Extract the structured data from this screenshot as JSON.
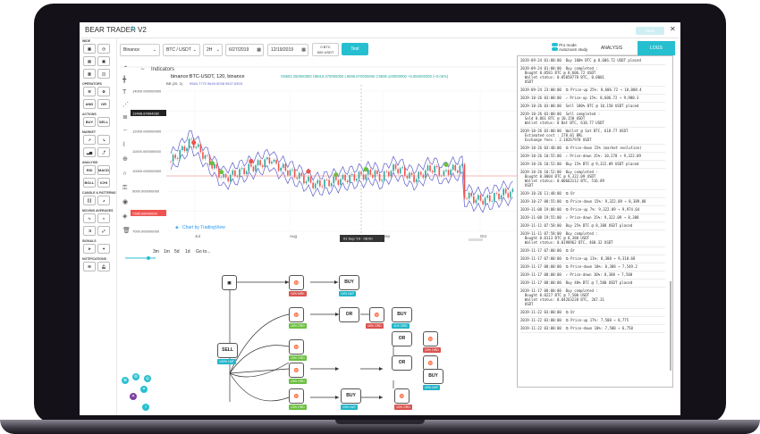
{
  "app": {
    "title": "BEAR TRADER V2",
    "save_label": "Save"
  },
  "sidebar": {
    "sections": [
      "WIDE",
      "OPERATORS",
      "ACTIONS",
      "MARKET",
      "ANALYSIS",
      "CANDLE & PATTERNS",
      "MOVING AVERAGES",
      "SIGNALS",
      "NOTIFICATIONS"
    ],
    "and_label": "AND",
    "or_label": "OR",
    "buy_label": "BUY",
    "sell_label": "SELL",
    "rsi_label": "RSI",
    "macd_label": "MACD",
    "boll_label": "BOLL",
    "ichi_label": "ICHI"
  },
  "controls": {
    "exchange": "Binance",
    "pair": "BTC / USDT",
    "interval": "2H",
    "start_date": "6/27/2019",
    "end_date": "12/19/2019",
    "balance_btc": "0 BTC",
    "balance_usdt": "500 USDT",
    "test_label": "Test"
  },
  "mode": {
    "pro": "Pro mode",
    "autozoom": "Autozoom study"
  },
  "tabs": {
    "analysis": "ANALYSIS",
    "logs": "LOGS"
  },
  "chart": {
    "indicators_label": "Indicators",
    "symbol": "binance:BTC-USDT, 120, binance",
    "ohlc": "O9602.250000000  H9619.370000000  L9595.870000000  C9608.100000000  +5.850000000 (+0.06%)",
    "bb_label": "BB (20, 2)",
    "bb_values": "9563.7770  9649.9038  9537.6303",
    "y_ticks": [
      "14000.000000000",
      "13000.000000000",
      "12000.000000000",
      "11000.000000000",
      "10000.000000000",
      "9000.000000000",
      "8000.000000000",
      "7000.000000000"
    ],
    "price_label_top": "13498.87894282",
    "price_label_bottom": "7385.68000000",
    "x_ticks": [
      "Jul",
      "Aug",
      "Sep",
      "Oct"
    ],
    "crosshair_date": "01 Sep '19 · 08:00",
    "watermark": "Chart by TradingView",
    "ranges": [
      "3m",
      "1m",
      "5d",
      "1d",
      "Go to..."
    ]
  },
  "logs": [
    "2019-09-24 01:00:00  Buy 100% BTC @ 8,606.72 USDT placed",
    "2019-09-24 01:00:00  Buy completed :\n  Bought 0.0581 BTC @ 8,606.72 USDT\n  Wallet status: 0.05058778 BTC, 0.0001\n  USDT",
    "2019-09-24 23:00:00  ⏲ Price-up 25%: 8,606.72 ➔ 10,008.4",
    "2019-10-26 03:00:00  ✓ Price-up 15%: 8,606.72 ➔ 9,980.3",
    "2019-10-26 03:00:00  Sell 100% BTC @ 10,150 USDT placed",
    "2019-10-26 03:00:00  Sell completed :\n  Sold 0.061 BTC @ 10,150 USDT\n  Wallet status: 0 Bat BTC, 618.77 USDT",
    "2019-10-26 03:00:00  Wallet @ Sat BTC, 618.77 USDT\n  Estimated cost : 278.01 BRL\n  Exchange fees : 2.18267978 USDT",
    "2019-10-26 03:40:00  ⏲ Price-down 15% (market evolution)",
    "2019-10-26 10:55:00  ✓ Price-down 15%: 10,278 ➔ 9,322.09",
    "2019-10-26 10:52:00  Buy 15% BTC @ 9,322.09 USDT placed",
    "2019-10-26 10:52:00  Buy completed :\n  Bought 0.0004 BTC @ 9,322.09 USDT\n  Wallet status: 0.00663112 BTC, 516.89\n  USDT",
    "2019-10-26 11:40:00  ⏲ Or",
    "2019-10-27 08:55:00  ⏲ Price-down 15%: 9,322.09 ➔ 8,389.88",
    "2019-11-08 19:00:00  ⏲ Price-up 7%: 9,322.09 ➔ 9,974.64",
    "2019-11-08 19:55:00  ✓ Price-down 15%: 9,322.09 ➔ 8,388",
    "2019-11-11 07:58:00  Buy 25% BTC @ 8,388 USDT placed",
    "2019-11-11 07:58:00  Buy completed :\n  Bought 0.0113 BTC @ 8,388 USDT\n  Wallet status: 0.0198962 BTC, 460.32 USDT",
    "2019-11-17 07:00:00  ⏲ Or",
    "2019-11-17 07:00:00  ⏲ Price-up 11%: 8,388 ➔ 9,310.68",
    "2019-11-17 08:00:00  ⏲ Price-down 10%: 8,388 ➔ 7,549.2",
    "2019-11-17 08:00:00  ✓ Price-down 10%: 8,388 ➔ 7,500",
    "2019-11-17 08:00:00  Buy 40% BTC @ 7,500 USDT placed",
    "2019-11-17 08:00:00  Buy completed :\n  Bought 0.0227 BTC @ 7,500 USDT\n  Wallet status: 0.04263228 BTC, 267.31\n  USDT",
    "2019-11-22 03:00:00  ⏲ Or",
    "2019-11-22 03:00:00  ⏲ Price-up 17%: 7,500 ➔ 8,775",
    "2019-11-22 03:00:00  ⏲ Price-down 10%: 7,500 ➔ 6,750"
  ],
  "flow": {
    "sell_label": "SELL",
    "buy_label": "BUY",
    "or_label": "OR",
    "badges": [
      "10% LMT",
      "10% MRK",
      "10% LMT",
      "15% GRD",
      "15% ORD",
      "15% ORD",
      "11% ORD",
      "15% ORD",
      "10% ORD",
      "40% LMT",
      "10% ORD",
      "13% ORD",
      "15% ORD",
      "100% LMT",
      "15% ORD"
    ]
  },
  "colors": {
    "accent": "#26bfd0",
    "buy": "#6abf3f",
    "sell": "#d9534f",
    "chart_up": "#26a69a",
    "chart_down": "#ef5350",
    "bb": "#5c5fc9"
  }
}
